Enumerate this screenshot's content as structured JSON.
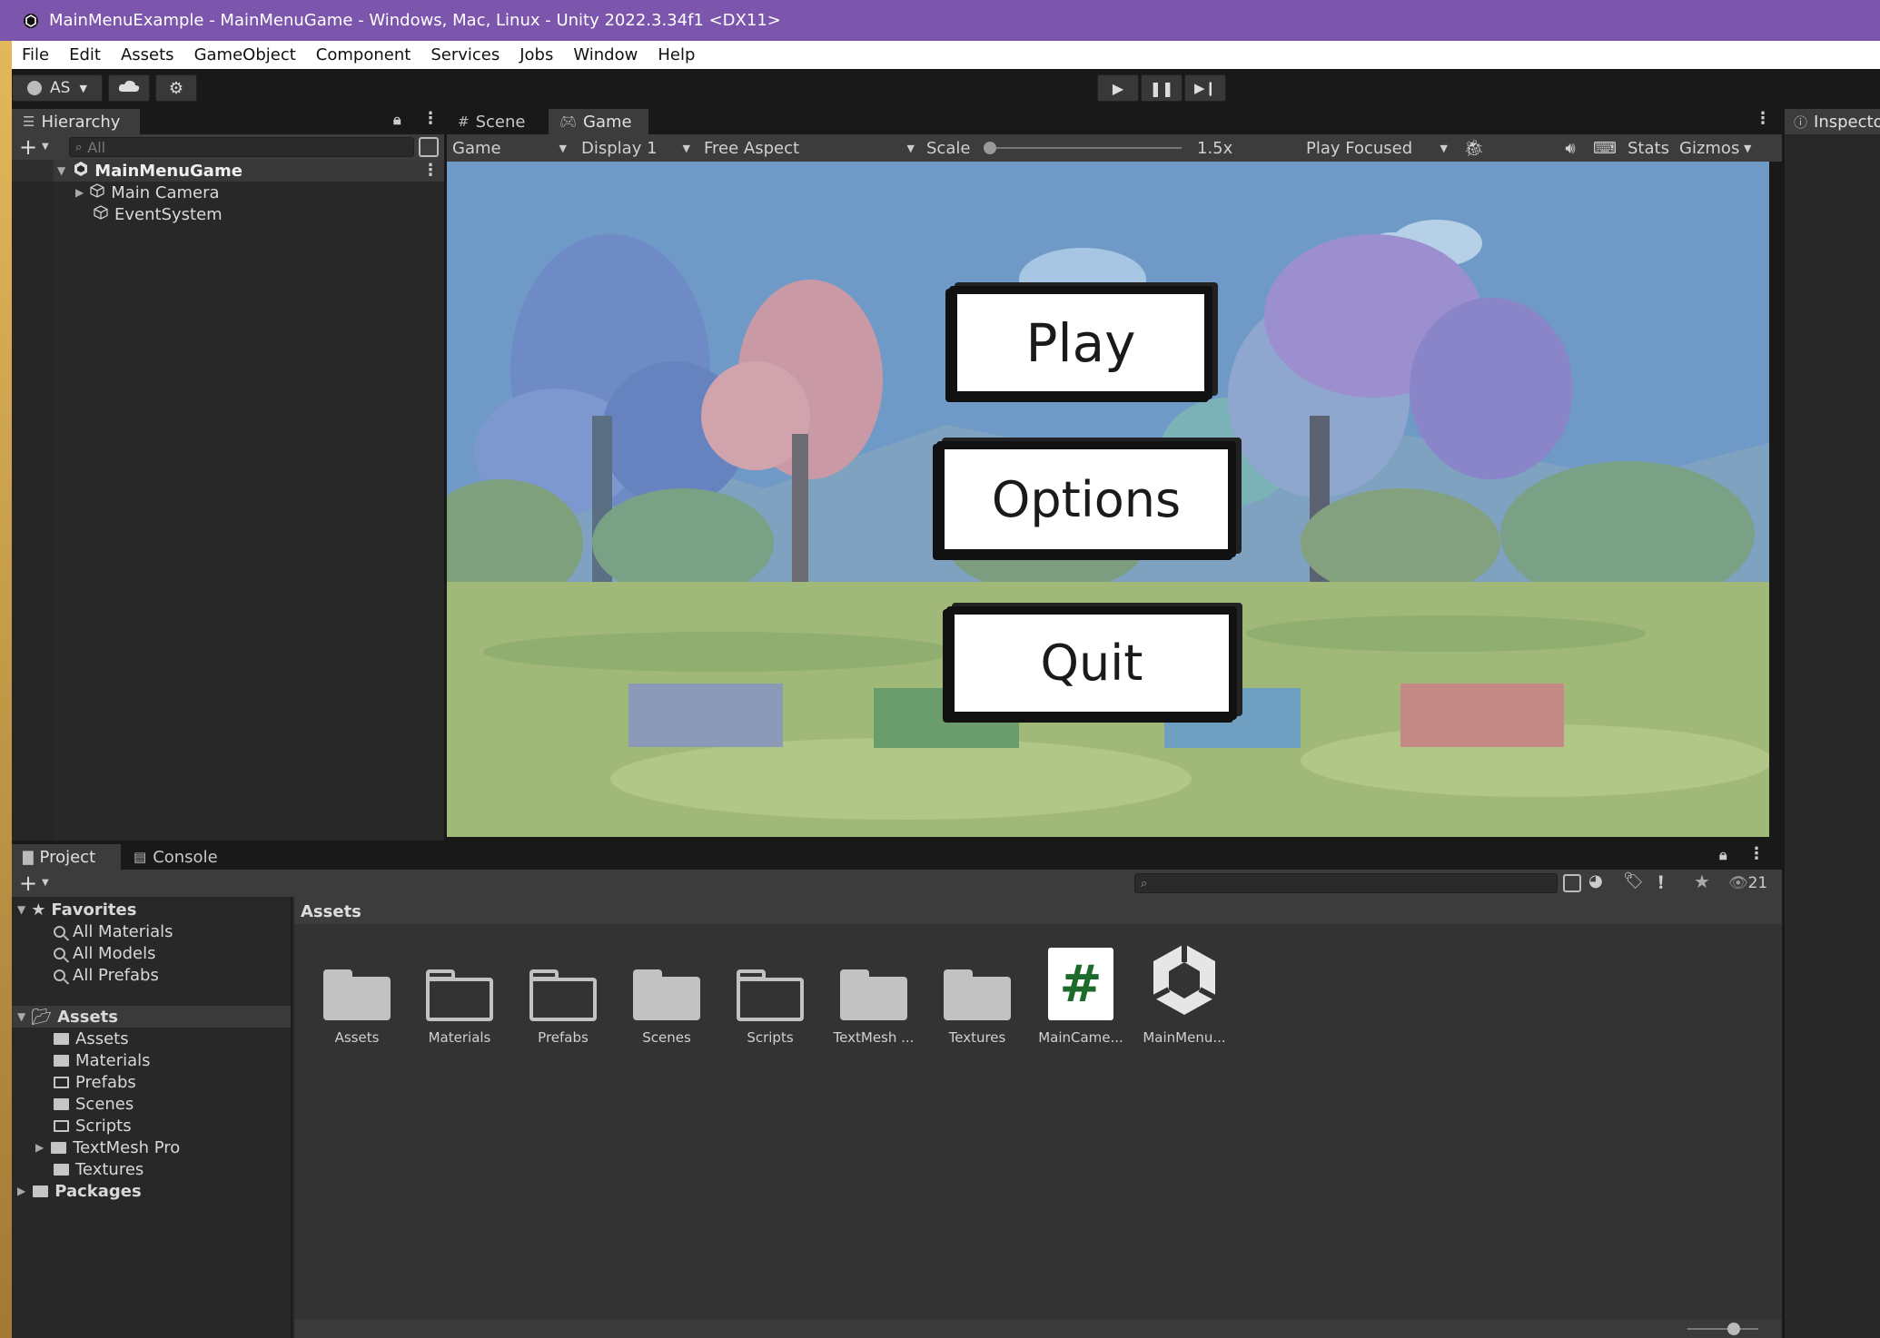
{
  "window": {
    "title": "MainMenuExample - MainMenuGame - Windows, Mac, Linux - Unity 2022.3.34f1 <DX11>"
  },
  "menu": [
    "File",
    "Edit",
    "Assets",
    "GameObject",
    "Component",
    "Services",
    "Jobs",
    "Window",
    "Help"
  ],
  "toolbar": {
    "account_label": "AS"
  },
  "hierarchy": {
    "tab_label": "Hierarchy",
    "search_placeholder": "All",
    "scene_name": "MainMenuGame",
    "items": [
      "Main Camera",
      "EventSystem"
    ]
  },
  "scene_tab": {
    "label": "Scene"
  },
  "game_tab": {
    "label": "Game",
    "toolbar": {
      "mode": "Game",
      "display": "Display 1",
      "aspect": "Free Aspect",
      "scale_label": "Scale",
      "scale_value": "1.5x",
      "scale_fraction": 0.0,
      "play_mode": "Play Focused",
      "stats": "Stats",
      "gizmos": "Gizmos"
    },
    "buttons": {
      "play": "Play",
      "options": "Options",
      "quit": "Quit"
    }
  },
  "inspector": {
    "tab_label": "Inspector"
  },
  "project": {
    "tab_label": "Project",
    "console_label": "Console",
    "hidden_count": "21",
    "favorites": {
      "label": "Favorites",
      "items": [
        "All Materials",
        "All Models",
        "All Prefabs"
      ]
    },
    "tree": {
      "root": "Assets",
      "children": [
        "Assets",
        "Materials",
        "Prefabs",
        "Scenes",
        "Scripts",
        "TextMesh Pro",
        "Textures"
      ],
      "packages": "Packages"
    },
    "breadcrumb": "Assets",
    "assets": [
      "Assets",
      "Materials",
      "Prefabs",
      "Scenes",
      "Scripts",
      "TextMesh ...",
      "Textures",
      "MainCame...",
      "MainMenu..."
    ],
    "script_glyph": "#"
  }
}
